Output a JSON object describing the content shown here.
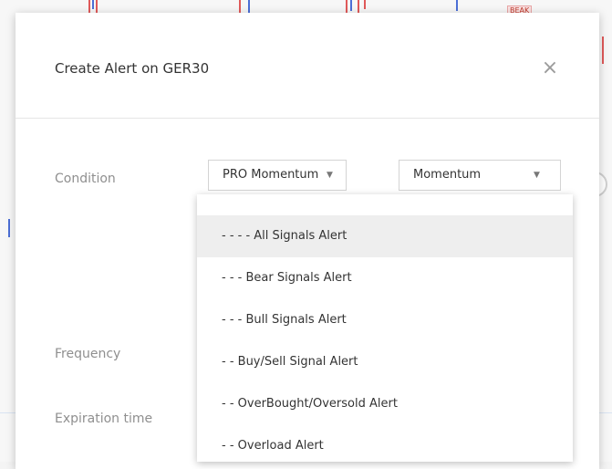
{
  "dialog": {
    "title": "Create Alert on GER30",
    "close_icon": "×"
  },
  "form": {
    "condition_label": "Condition",
    "frequency_label": "Frequency",
    "expiration_label": "Expiration time",
    "indicator_select": "PRO Momentum",
    "plot_select": "Momentum",
    "caret_icon": "▼"
  },
  "dropdown": {
    "options": [
      {
        "label": "- - - - All Signals Alert",
        "selected": true
      },
      {
        "label": "- - - Bear Signals Alert",
        "selected": false
      },
      {
        "label": "- - - Bull Signals Alert",
        "selected": false
      },
      {
        "label": "- - Buy/Sell Signal Alert",
        "selected": false
      },
      {
        "label": "- - OverBought/Oversold Alert",
        "selected": false
      },
      {
        "label": "- - Overload Alert",
        "selected": false
      }
    ]
  },
  "background": {
    "chart_tag": "BEAK"
  },
  "colors": {
    "bearish": "#e05a5a",
    "bullish": "#4c6fd6",
    "selected_row": "#eeeeee"
  }
}
